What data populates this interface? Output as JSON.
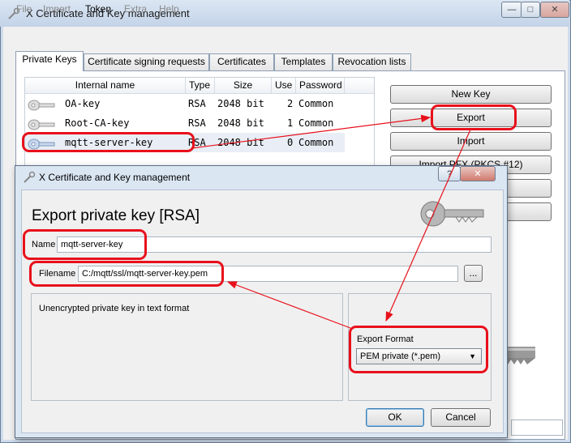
{
  "window": {
    "title": "X Certificate and Key management",
    "min": "—",
    "max": "□",
    "close": "✕"
  },
  "menu": {
    "file": "File",
    "import": "Import",
    "token": "Token",
    "extra": "Extra",
    "help": "Help"
  },
  "tabs": [
    "Private Keys",
    "Certificate signing requests",
    "Certificates",
    "Templates",
    "Revocation lists"
  ],
  "table": {
    "headers": [
      "Internal name",
      "Type",
      "Size",
      "Use",
      "Password"
    ],
    "rows": [
      {
        "name": "OA-key",
        "type": "RSA",
        "size": "2048 bit",
        "use": "2",
        "password": "Common"
      },
      {
        "name": "Root-CA-key",
        "type": "RSA",
        "size": "2048 bit",
        "use": "1",
        "password": "Common"
      },
      {
        "name": "mqtt-server-key",
        "type": "RSA",
        "size": "2048 bit",
        "use": "0",
        "password": "Common"
      }
    ]
  },
  "side_buttons": {
    "new_key": "New Key",
    "export": "Export",
    "import": "Import",
    "import_pfx": "Import PFX (PKCS #12)"
  },
  "dialog": {
    "title": "X Certificate and Key management",
    "help": "?",
    "close": "✕",
    "heading": "Export private key [RSA]",
    "name_label": "Name",
    "name_value": "mqtt-server-key",
    "filename_label": "Filename",
    "filename_value": "C:/mqtt/ssl/mqtt-server-key.pem",
    "browse": "...",
    "description": "Unencrypted private key in text format",
    "format_label": "Export Format",
    "format_value": "PEM private (*.pem)",
    "ok": "OK",
    "cancel": "Cancel"
  },
  "colors": {
    "annotation": "#e8101b",
    "accent": "#3b6fb6"
  }
}
